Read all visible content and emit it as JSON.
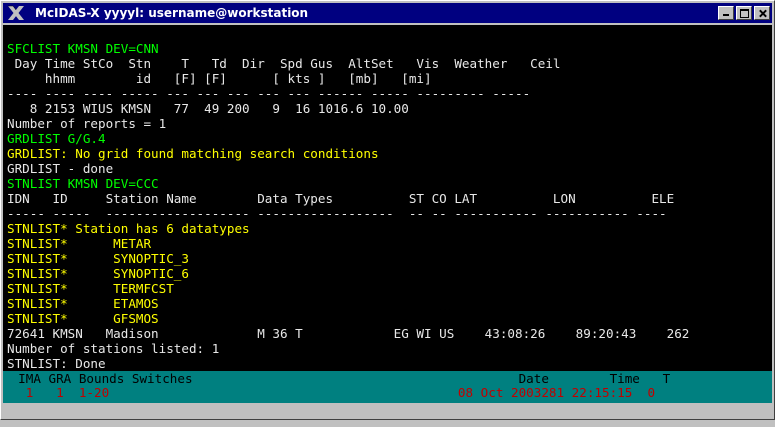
{
  "window": {
    "title": "McIDAS-X yyyyl: username@workstation",
    "icon": "x-logo-icon",
    "controls": [
      "minimize",
      "maximize",
      "close"
    ]
  },
  "terminal": {
    "lines": [
      {
        "text": "SFCLIST KMSN DEV=CNN",
        "color": "green"
      },
      {
        "text": " Day Time StCo  Stn    T   Td  Dir  Spd Gus  AltSet   Vis  Weather   Ceil",
        "color": "white"
      },
      {
        "text": "     hhmm        id   [F] [F]      [ kts ]   [mb]   [mi]",
        "color": "white"
      },
      {
        "text": "---- ---- ---- ----- --- --- --- --- --- ------ ----- --------- -----",
        "color": "white"
      },
      {
        "text": "   8 2153 WIUS KMSN   77  49 200   9  16 1016.6 10.00",
        "color": "white"
      },
      {
        "text": "Number of reports = 1",
        "color": "white"
      },
      {
        "text": "GRDLIST G/G.4",
        "color": "green"
      },
      {
        "text": "GRDLIST: No grid found matching search conditions",
        "color": "yellow"
      },
      {
        "text": "GRDLIST - done",
        "color": "white"
      },
      {
        "text": "STNLIST KMSN DEV=CCC",
        "color": "green"
      },
      {
        "text": "IDN   ID     Station Name        Data Types          ST CO LAT          LON          ELE",
        "color": "white"
      },
      {
        "text": "----- -----  ------------------- ------------------  -- -- ----------- ----------- ----",
        "color": "white"
      },
      {
        "text": "STNLIST* Station has 6 datatypes",
        "color": "yellow"
      },
      {
        "text": "STNLIST*      METAR",
        "color": "yellow"
      },
      {
        "text": "STNLIST*      SYNOPTIC_3",
        "color": "yellow"
      },
      {
        "text": "STNLIST*      SYNOPTIC_6",
        "color": "yellow"
      },
      {
        "text": "STNLIST*      TERMFCST",
        "color": "yellow"
      },
      {
        "text": "STNLIST*      ETAMOS",
        "color": "yellow"
      },
      {
        "text": "STNLIST*      GFSMOS",
        "color": "yellow"
      },
      {
        "text": "72641 KMSN   Madison             M 36 T            EG WI US    43:08:26    89:20:43    262",
        "color": "white"
      },
      {
        "text": "Number of stations listed: 1",
        "color": "white"
      },
      {
        "text": "STNLIST: Done",
        "color": "white"
      }
    ]
  },
  "status": {
    "header": "  IMA GRA Bounds Switches                                           Date        Time   T",
    "values": "   1   1  1-20                                              08 Oct 2003281 22:15:15  0"
  }
}
